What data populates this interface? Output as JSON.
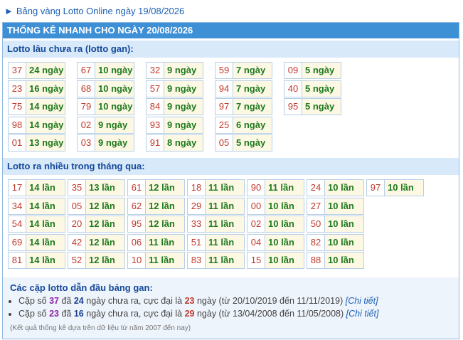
{
  "top_link": "Bảng vàng Lotto Online ngày 19/08/2026",
  "header_title": "THỐNG KÊ NHANH CHO NGÀY 20/08/2026",
  "section_gan": {
    "title": "Lotto lâu chưa ra (lotto gan):",
    "columns": [
      [
        {
          "num": "37",
          "val": "24 ngày"
        },
        {
          "num": "23",
          "val": "16 ngày"
        },
        {
          "num": "75",
          "val": "14 ngày"
        },
        {
          "num": "98",
          "val": "14 ngày"
        },
        {
          "num": "01",
          "val": "13 ngày"
        }
      ],
      [
        {
          "num": "67",
          "val": "10 ngày"
        },
        {
          "num": "68",
          "val": "10 ngày"
        },
        {
          "num": "79",
          "val": "10 ngày"
        },
        {
          "num": "02",
          "val": "9 ngày"
        },
        {
          "num": "03",
          "val": "9 ngày"
        }
      ],
      [
        {
          "num": "32",
          "val": "9 ngày"
        },
        {
          "num": "57",
          "val": "9 ngày"
        },
        {
          "num": "84",
          "val": "9 ngày"
        },
        {
          "num": "93",
          "val": "9 ngày"
        },
        {
          "num": "91",
          "val": "8 ngày"
        }
      ],
      [
        {
          "num": "59",
          "val": "7 ngày"
        },
        {
          "num": "94",
          "val": "7 ngày"
        },
        {
          "num": "97",
          "val": "7 ngày"
        },
        {
          "num": "25",
          "val": "6 ngày"
        },
        {
          "num": "05",
          "val": "5 ngày"
        }
      ],
      [
        {
          "num": "09",
          "val": "5 ngày"
        },
        {
          "num": "40",
          "val": "5 ngày"
        },
        {
          "num": "95",
          "val": "5 ngày"
        }
      ]
    ]
  },
  "section_frequent": {
    "title": "Lotto ra nhiều trong tháng qua:",
    "columns": [
      [
        {
          "num": "17",
          "val": "14 lần"
        },
        {
          "num": "34",
          "val": "14 lần"
        },
        {
          "num": "54",
          "val": "14 lần"
        },
        {
          "num": "69",
          "val": "14 lần"
        },
        {
          "num": "81",
          "val": "14 lần"
        }
      ],
      [
        {
          "num": "35",
          "val": "13 lần"
        },
        {
          "num": "05",
          "val": "12 lần"
        },
        {
          "num": "20",
          "val": "12 lần"
        },
        {
          "num": "42",
          "val": "12 lần"
        },
        {
          "num": "52",
          "val": "12 lần"
        }
      ],
      [
        {
          "num": "61",
          "val": "12 lần"
        },
        {
          "num": "62",
          "val": "12 lần"
        },
        {
          "num": "95",
          "val": "12 lần"
        },
        {
          "num": "06",
          "val": "11 lần"
        },
        {
          "num": "10",
          "val": "11 lần"
        }
      ],
      [
        {
          "num": "18",
          "val": "11 lần"
        },
        {
          "num": "29",
          "val": "11 lần"
        },
        {
          "num": "33",
          "val": "11 lần"
        },
        {
          "num": "51",
          "val": "11 lần"
        },
        {
          "num": "83",
          "val": "11 lần"
        }
      ],
      [
        {
          "num": "90",
          "val": "11 lần"
        },
        {
          "num": "00",
          "val": "10 lần"
        },
        {
          "num": "02",
          "val": "10 lần"
        },
        {
          "num": "04",
          "val": "10 lần"
        },
        {
          "num": "15",
          "val": "10 lần"
        }
      ],
      [
        {
          "num": "24",
          "val": "10 lần"
        },
        {
          "num": "27",
          "val": "10 lần"
        },
        {
          "num": "50",
          "val": "10 lần"
        },
        {
          "num": "82",
          "val": "10 lần"
        },
        {
          "num": "88",
          "val": "10 lần"
        }
      ],
      [
        {
          "num": "97",
          "val": "10 lần"
        }
      ]
    ]
  },
  "summary": {
    "title": "Các cặp lotto dẫn đầu bảng gan:",
    "items": [
      {
        "pre": "Cặp số ",
        "pair": "37",
        "mid1": " đã ",
        "days": "24",
        "mid2": " ngày chưa ra, cực đại là ",
        "max": "23",
        "mid3": " ngày (từ 20/10/2019 đến 11/11/2019) ",
        "link": "[Chi tiết]"
      },
      {
        "pre": "Cặp số ",
        "pair": "23",
        "mid1": " đã ",
        "days": "16",
        "mid2": " ngày chưa ra, cực đại là ",
        "max": "29",
        "mid3": " ngày (từ 13/04/2008 đến 11/05/2008) ",
        "link": "[Chi tiết]"
      }
    ],
    "note": "(Kết quả thống kê dựa trên dữ liệu từ năm 2007 đến nay)"
  }
}
